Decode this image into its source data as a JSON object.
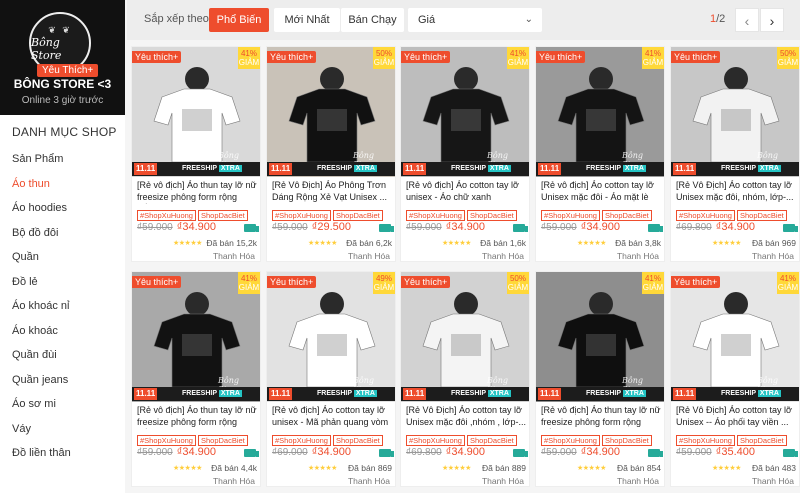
{
  "shop": {
    "logo_text": "Bông Store",
    "favorite_badge": "Yêu Thích+",
    "name": "BÔNG STORE <3",
    "online": "Online 3 giờ trước"
  },
  "category_title": "DANH MỤC SHOP",
  "categories": [
    {
      "label": "Sản Phẩm"
    },
    {
      "label": "Áo thun"
    },
    {
      "label": "Áo hoodies"
    },
    {
      "label": "Bộ đồ đôi"
    },
    {
      "label": "Quần"
    },
    {
      "label": "Đồ lẻ"
    },
    {
      "label": "Áo khoác nỉ"
    },
    {
      "label": "Áo khoác"
    },
    {
      "label": "Quần đùi"
    },
    {
      "label": "Quần jeans"
    },
    {
      "label": "Áo sơ mi"
    },
    {
      "label": "Váy"
    },
    {
      "label": "Đồ liền thân"
    }
  ],
  "active_category": "Áo thun",
  "sortbar": {
    "label": "Sắp xếp theo",
    "popular": "Phổ Biến",
    "newest": "Mới Nhất",
    "bestselling": "Bán Chạy",
    "price": "Giá",
    "page_current": "1",
    "page_total": "/2"
  },
  "colors": {
    "accent": "#ee4d2d",
    "star": "#ffce3d",
    "freeship": "#26aa99"
  },
  "common": {
    "fav_tag": "Yêu thích+",
    "discount_suffix": "GIẢM",
    "d11": "11.11",
    "freeship": "FREESHIP",
    "xtra": "XTRA",
    "tag1": "#ShopXuHuong",
    "tag2": "ShopDacBiet",
    "location": "Thanh Hóa",
    "watermark": "Bông Store"
  },
  "products": [
    {
      "title": "[Rẻ vô địch] Áo thun tay lỡ nữ freesize phông form rộng dấu...",
      "discount": "41%",
      "old_price": "₫59.000",
      "new_price": "₫34.900",
      "sold": "Đã bán 15,2k",
      "stars": "★★★★★",
      "fav": true,
      "bg": "#d9d9d9",
      "shirt": "#ffffff"
    },
    {
      "title": "[Rẻ Vô Địch] Áo Phông Trơn Dáng Rộng Xẻ Vạt Unisex ...",
      "discount": "50%",
      "old_price": "₫59.000",
      "new_price": "₫29.500",
      "sold": "Đã bán 6,2k",
      "stars": "★★★★★",
      "fav": true,
      "bg": "#c9c2b8",
      "shirt": "#111111"
    },
    {
      "title": "[Rẻ vô địch] Áo cotton tay lỡ unisex - Áo chữ xanh FUTURE ...",
      "discount": "41%",
      "old_price": "₫59.000",
      "new_price": "₫34.900",
      "sold": "Đã bán 1,6k",
      "stars": "★★★★★",
      "fav": true,
      "bg": "#bdbdbd",
      "shirt": "#161616"
    },
    {
      "title": "[Rẻ vô địch] Áo cotton tay lỡ Unisex mặc đôi - Áo mặt lè lưỡi ...",
      "discount": "41%",
      "old_price": "₫59.000",
      "new_price": "₫34.900",
      "sold": "Đã bán 3,8k",
      "stars": "★★★★★",
      "fav": true,
      "bg": "#9a9a9a",
      "shirt": "#141414"
    },
    {
      "title": "[Rẻ Vô Địch] Áo cotton tay lỡ Unisex mặc đôi, nhóm, lớp-...",
      "discount": "50%",
      "old_price": "₫69.800",
      "new_price": "₫34.900",
      "sold": "Đã bán 969",
      "stars": "★★★★★",
      "fav": true,
      "bg": "#c7c7c7",
      "shirt": "#f2f2f2"
    },
    {
      "title": "[Rẻ vô địch] Áo thun tay lỡ nữ freesize phông form rộng dấu...",
      "discount": "41%",
      "old_price": "₫59.000",
      "new_price": "₫34.900",
      "sold": "Đã bán 4,4k",
      "stars": "★★★★★",
      "fav": true,
      "bg": "#a9a9a9",
      "shirt": "#121212"
    },
    {
      "title": "[Rẻ vô địch] Áo cotton tay lỡ unisex - Mã phản quang vòm ...",
      "discount": "49%",
      "old_price": "₫69.000",
      "new_price": "₫34.900",
      "sold": "Đã bán 869",
      "stars": "★★★★★",
      "fav": true,
      "bg": "#e2e2e2",
      "shirt": "#ffffff"
    },
    {
      "title": "[Rẻ Vô Địch] Áo cotton tay lỡ Unisex mặc đôi ,nhóm , lớp-...",
      "discount": "50%",
      "old_price": "₫69.800",
      "new_price": "₫34.900",
      "sold": "Đã bán 889",
      "stars": "★★★★★",
      "fav": true,
      "bg": "#d2d2d2",
      "shirt": "#f4f4f4"
    },
    {
      "title": "[Rẻ vô địch] Áo thun tay lỡ nữ freesize phông form rộng dấu...",
      "discount": "41%",
      "old_price": "₫59.000",
      "new_price": "₫34.900",
      "sold": "Đã bán 854",
      "stars": "★★★★★",
      "fav": false,
      "bg": "#8e8e8e",
      "shirt": "#0f0f0f"
    },
    {
      "title": "[Rẻ Vô Địch] Áo cotton tay lỡ Unisex -- Áo phối tay viền ...",
      "discount": "41%",
      "old_price": "₫59.000",
      "new_price": "₫35.400",
      "sold": "Đã bán 483",
      "stars": "★★★★★",
      "fav": true,
      "bg": "#e6e6e6",
      "shirt": "#ffffff"
    }
  ]
}
